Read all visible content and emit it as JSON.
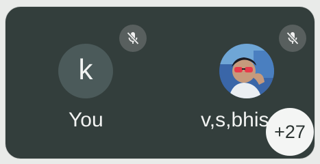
{
  "participants": [
    {
      "avatar_letter": "k",
      "name": "You",
      "mic_icon": "mic-off-icon"
    },
    {
      "avatar_icon": "profile-photo",
      "name": "v,s,bhise",
      "mic_icon": "mic-off-icon"
    }
  ],
  "overflow_count": "+27",
  "colors": {
    "panel_bg": "#333e3c",
    "avatar_bg": "#4b5a5a",
    "mute_bg": "#585f5e",
    "text": "#f3f4f3"
  }
}
